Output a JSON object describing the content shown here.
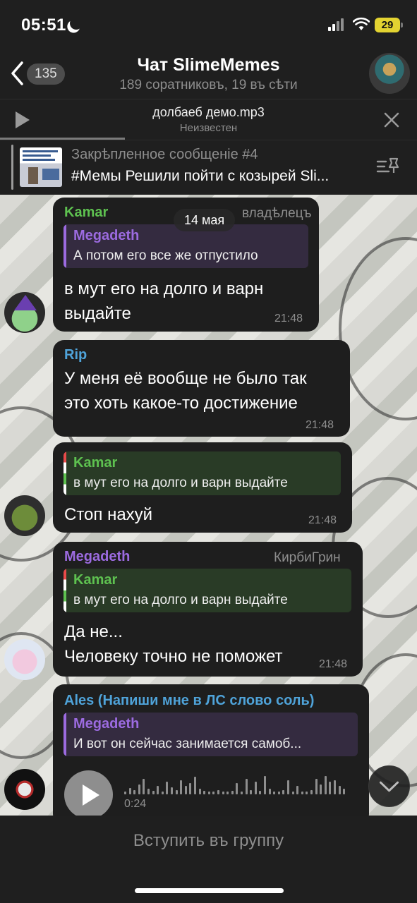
{
  "status": {
    "time": "05:51",
    "battery": "29"
  },
  "header": {
    "back_count": "135",
    "title": "Чат SlimeMemes",
    "subtitle": "189 соратниковъ, 19 въ сѣти"
  },
  "player": {
    "title": "долбаеб демо.mp3",
    "artist": "Неизвестен",
    "progress": 0.3
  },
  "pinned": {
    "label": "Закрѣпленное сообщеніе #4",
    "text": "#Мемы Решили пойти с козырей Sli..."
  },
  "date_pill": "14 мая",
  "messages": [
    {
      "sender": "Kamar",
      "role": "владѣлецъ",
      "reply": {
        "name": "Megadeth",
        "text": "А потом его все же отпустило"
      },
      "lines": [
        "в мут его на долго и варн",
        "выдайте"
      ],
      "time": "21:48"
    },
    {
      "sender": "Rip",
      "lines": [
        "У меня её вообще не было так",
        "это хоть какое-то достижение"
      ],
      "time": "21:48"
    },
    {
      "reply": {
        "name": "Kamar",
        "text": "в мут его на долго и варн выдайте"
      },
      "lines": [
        "Стоп нахуй"
      ],
      "time": "21:48"
    },
    {
      "sender": "Megadeth",
      "role": "КирбиГрин",
      "reply": {
        "name": "Kamar",
        "text": "в мут его на долго и варн выдайте"
      },
      "lines": [
        "Да не...",
        "Человеку точно не поможет"
      ],
      "time": "21:48"
    },
    {
      "sender": "Ales (Напиши мне в ЛС слово соль)",
      "reply": {
        "name": "Megadeth",
        "text": "И вот он сейчас занимается самоб..."
      },
      "voice_duration": "0:24"
    }
  ],
  "footer": {
    "join_label": "Вступить въ группу"
  },
  "colors": {
    "kamar": "#5ec150",
    "rip": "#4fa3d9",
    "megadeth": "#9c6be0",
    "ales": "#4fa3d9",
    "bubble": "#1e1e1e",
    "bar_bg": "#1f1f1f"
  },
  "icons": [
    "back-chevron-icon",
    "play-icon",
    "close-icon",
    "pin-list-icon",
    "chevron-down-icon",
    "moon-icon",
    "wifi-icon",
    "signal-icon"
  ]
}
